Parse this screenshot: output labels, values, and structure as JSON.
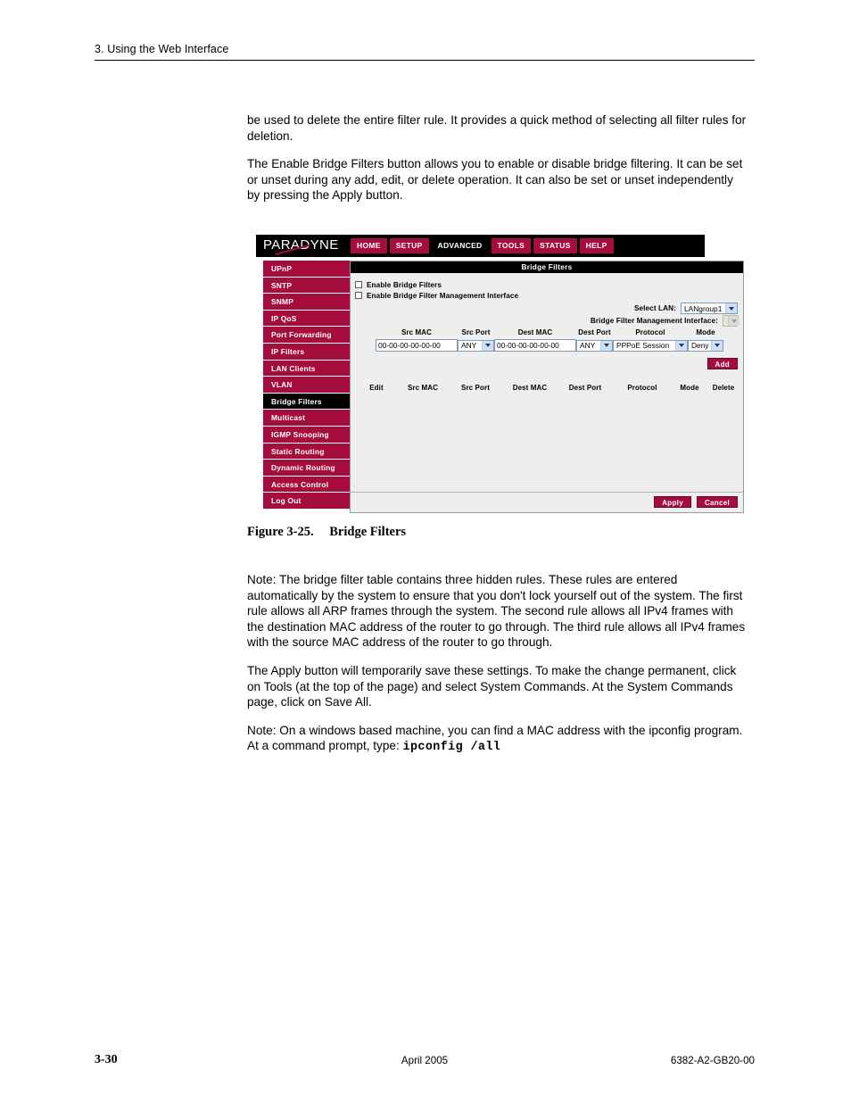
{
  "page": {
    "running_head": "3. Using the Web Interface",
    "footer_page_number": "3-30",
    "footer_date": "April 2005",
    "footer_docnum": "6382-A2-GB20-00"
  },
  "prose_top": [
    "be used to delete the entire filter rule. It provides a quick method of selecting all filter rules for deletion.",
    "The Enable Bridge Filters button allows you to enable or disable bridge filtering. It can be set or unset during any add, edit, or delete operation. It can also be set or unset independently by pressing the Apply button."
  ],
  "figure": {
    "number": "Figure 3-25.",
    "title": "Bridge Filters"
  },
  "prose_bottom": [
    "Note: The bridge filter table contains three hidden rules. These rules are entered automatically by the system to ensure that you don't lock yourself out of the system. The first rule allows all ARP frames through the system. The second rule allows all IPv4 frames with the destination MAC address of the router to go through. The third rule allows all IPv4 frames with the source MAC address of the router to go through.",
    "The Apply button will temporarily save these settings. To make the change permanent, click on Tools (at the top of the page) and select System Commands. At the System Commands page, click on Save All."
  ],
  "prose_bottom_last": {
    "text": "Note: On a windows based machine, you can find a MAC address with the ipconfig program. At a command prompt, type: ",
    "code": "ipconfig /all"
  },
  "screenshot": {
    "brand": "PARADYNE",
    "nav": [
      {
        "label": "HOME",
        "active": false
      },
      {
        "label": "SETUP",
        "active": false
      },
      {
        "label": "ADVANCED",
        "active": true
      },
      {
        "label": "TOOLS",
        "active": false
      },
      {
        "label": "STATUS",
        "active": false
      },
      {
        "label": "HELP",
        "active": false
      }
    ],
    "sidebar": [
      {
        "label": "UPnP",
        "active": false
      },
      {
        "label": "SNTP",
        "active": false
      },
      {
        "label": "SNMP",
        "active": false
      },
      {
        "label": "IP QoS",
        "active": false
      },
      {
        "label": "Port Forwarding",
        "active": false
      },
      {
        "label": "IP Filters",
        "active": false
      },
      {
        "label": "LAN Clients",
        "active": false
      },
      {
        "label": "VLAN",
        "active": false
      },
      {
        "label": "Bridge Filters",
        "active": true
      },
      {
        "label": "Multicast",
        "active": false
      },
      {
        "label": "IGMP Snooping",
        "active": false
      },
      {
        "label": "Static Routing",
        "active": false
      },
      {
        "label": "Dynamic Routing",
        "active": false
      },
      {
        "label": "Access Control",
        "active": false
      },
      {
        "label": "Log Out",
        "active": false
      }
    ],
    "panel_title": "Bridge Filters",
    "checkboxes": [
      {
        "label": "Enable Bridge Filters",
        "checked": false
      },
      {
        "label": "Enable Bridge Filter Management Interface",
        "checked": false
      }
    ],
    "select_lan": {
      "label": "Select LAN:",
      "value": "LANgroup1"
    },
    "bfmi": {
      "label": "Bridge Filter Management Interface:",
      "value": "",
      "disabled": true
    },
    "form": {
      "headers": [
        "Src MAC",
        "Src Port",
        "Dest MAC",
        "Dest Port",
        "Protocol",
        "Mode"
      ],
      "values": {
        "src_mac": "00-00-00-00-00-00",
        "src_port": "ANY",
        "dest_mac": "00-00-00-00-00-00",
        "dest_port": "ANY",
        "protocol": "PPPoE Session",
        "mode": "Deny"
      },
      "add_label": "Add"
    },
    "rules_table": {
      "headers": [
        "Edit",
        "Src MAC",
        "Src Port",
        "Dest MAC",
        "Dest Port",
        "Protocol",
        "Mode",
        "Delete"
      ],
      "rows": []
    },
    "footer_buttons": {
      "apply": "Apply",
      "cancel": "Cancel"
    },
    "colors": {
      "crimson": "#A50D3C",
      "black": "#000000",
      "panel_bg": "#EEEEEE"
    }
  }
}
